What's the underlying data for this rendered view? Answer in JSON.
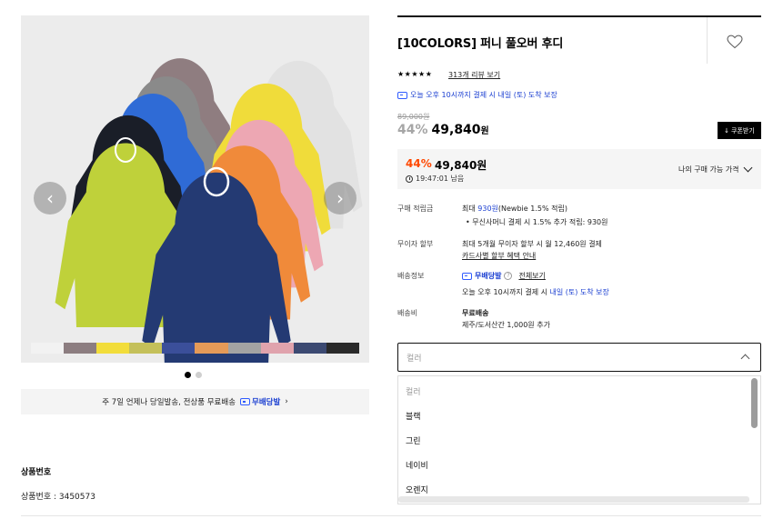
{
  "product": {
    "title": "[10COLORS] 퍼니 풀오버 후디",
    "stars": "★★★★★",
    "review_link": "313개 리뷰 보기",
    "delivery_notice": "오늘 오후 10시까지 결제 시 내일 (토) 도착 보장",
    "original_price": "89,000원",
    "discount_rate": "44%",
    "sale_price": "49,840",
    "won": "원",
    "coupon_button": "쿠폰받기"
  },
  "price_box": {
    "discount": "44%",
    "price": "49,840원",
    "timer": "19:47:01 남음",
    "my_price_label": "나의 구매 가능 가격"
  },
  "info": {
    "points_label": "구매 적립금",
    "points_prefix": "최대 ",
    "points_amount": "930원",
    "points_suffix": "(Newbie 1.5% 적립)",
    "points_bullet": "•  무신사머니 결제 시 1.5% 추가 적립: 930원",
    "installment_label": "무이자 할부",
    "installment_text": "최대 5개월 무이자 할부 시 월 12,460원 결제",
    "installment_link": "카드사별 할부 혜택 안내",
    "shipping_label": "배송정보",
    "shipping_brand": "무배당발",
    "shipping_qmark": "?",
    "shipping_view_all": "전체보기",
    "shipping_notice_prefix": "오늘 오후 10시까지 결제 시 ",
    "shipping_notice_highlight": "내일 (토) 도착 보장",
    "fee_label": "배송비",
    "fee_free": "무료배송",
    "fee_extra": "제주/도서산간 1,000원 추가"
  },
  "select": {
    "placeholder": "컬러",
    "options": [
      "컬러",
      "블랙",
      "그린",
      "네이비",
      "오렌지"
    ]
  },
  "gallery": {
    "prev_icon": "‹",
    "next_icon": "›",
    "swatch_colors": [
      "#f2f2f2",
      "#8c7d80",
      "#f2dd3a",
      "#c4c05a",
      "#3b4f9a",
      "#e59a58",
      "#a3a3a3",
      "#e0a3ad",
      "#3c4a72",
      "#2a2a2a"
    ],
    "promo_text": "주 7일 언제나 당일발송, 전상품 무료배송",
    "promo_brand": "무배당발",
    "promo_arrow": "›"
  },
  "details": {
    "section_title": "상품번호",
    "product_number": "상품번호 : 3450573"
  }
}
